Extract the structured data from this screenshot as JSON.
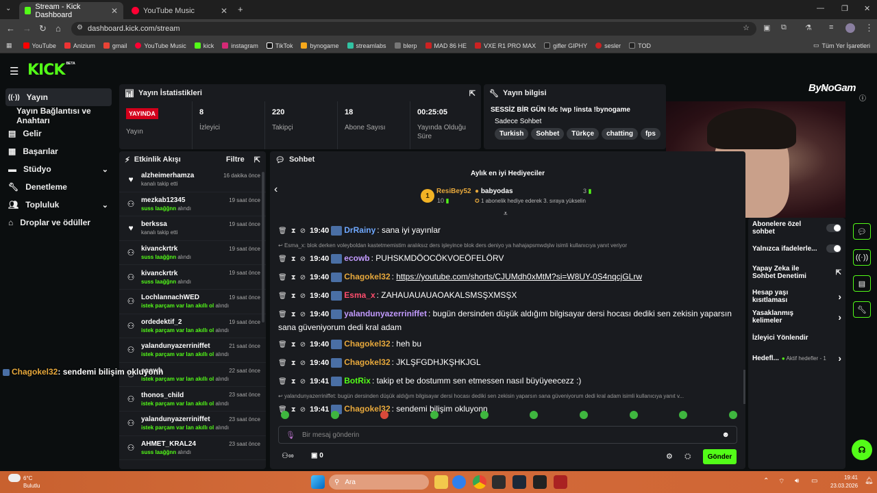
{
  "browser": {
    "tabs": [
      {
        "title": "Stream - Kick Dashboard",
        "active": true
      },
      {
        "title": "YouTube Music",
        "active": false
      }
    ],
    "url": "dashboard.kick.com/stream",
    "bookmarks": [
      "YouTube",
      "Anizium",
      "gmail",
      "YouTube Music",
      "kick",
      "instagram",
      "TikTok",
      "bynogame",
      "streamlabs",
      "blerp",
      "MAD 86 HE",
      "VXE R1 PRO MAX",
      "gifler GIPHY",
      "sesler",
      "TOD"
    ],
    "bookmarks_all": "Tüm Yer İşaretleri"
  },
  "kick": {
    "logo": "KICK",
    "beta": "BETA"
  },
  "sidebar": {
    "items": [
      {
        "label": "Yayın"
      },
      {
        "label": "Yayın Bağlantısı ve Anahtarı"
      },
      {
        "label": "Gelir"
      },
      {
        "label": "Başarılar"
      },
      {
        "label": "Stüdyo"
      },
      {
        "label": "Denetleme"
      },
      {
        "label": "Topluluk"
      },
      {
        "label": "Droplar ve ödüller"
      }
    ]
  },
  "stats": {
    "title": "Yayın İstatistikleri",
    "live_badge": "YAYINDA",
    "live_label": "Yayın",
    "cells": [
      {
        "value": "8",
        "label": "İzleyici"
      },
      {
        "value": "220",
        "label": "Takipçi"
      },
      {
        "value": "18",
        "label": "Abone Sayısı"
      },
      {
        "value": "00:25:05",
        "label": "Yayında Olduğu Süre"
      }
    ]
  },
  "info": {
    "title": "Yayın bilgisi",
    "stream_title": "SESSİZ BİR GÜN !dc !wp !insta !bynogame",
    "category": "Sadece Sohbet",
    "tags": [
      "Turkish",
      "Sohbet",
      "Türkçe",
      "chatting",
      "fps"
    ]
  },
  "overlay": {
    "brand": "ByNoGam"
  },
  "activity": {
    "title": "Etkinlik Akışı",
    "filter": "Filtre",
    "items": [
      {
        "name": "alzheimerhamza",
        "sub": "kanalı takip etti",
        "reward": "",
        "time": "16 dakika önce",
        "type": "follow"
      },
      {
        "name": "mezkab12345",
        "sub": "alındı",
        "reward": "suss laağğnn",
        "time": "19 saat önce",
        "type": "reward"
      },
      {
        "name": "berkssa",
        "sub": "kanalı takip etti",
        "reward": "",
        "time": "19 saat önce",
        "type": "follow"
      },
      {
        "name": "kivanckrtrk",
        "sub": "alındı",
        "reward": "suss laağğnn",
        "time": "19 saat önce",
        "type": "reward"
      },
      {
        "name": "kivanckrtrk",
        "sub": "alındı",
        "reward": "suss laağğnn",
        "time": "19 saat önce",
        "type": "reward"
      },
      {
        "name": "LochlannachWED",
        "sub": "alındı",
        "reward": "istek parçam var lan akıllı ol",
        "time": "19 saat önce",
        "type": "reward"
      },
      {
        "name": "ordedektif_2",
        "sub": "alındı",
        "reward": "istek parçam var lan akıllı ol",
        "time": "19 saat önce",
        "type": "reward"
      },
      {
        "name": "yalandunyazerriniffet",
        "sub": "alındı",
        "reward": "istek parçam var lan akıllı ol",
        "time": "21 saat önce",
        "type": "reward"
      },
      {
        "name": "ecowb",
        "sub": "alındı",
        "reward": "istek parçam var lan akıllı ol",
        "time": "22 saat önce",
        "type": "reward"
      },
      {
        "name": "thonos_child",
        "sub": "alındı",
        "reward": "istek parçam var lan akıllı ol",
        "time": "23 saat önce",
        "type": "reward"
      },
      {
        "name": "yalandunyazerriniffet",
        "sub": "alındı",
        "reward": "istek parçam var lan akıllı ol",
        "time": "23 saat önce",
        "type": "reward"
      },
      {
        "name": "AHMET_KRAL24",
        "sub": "alındı",
        "reward": "suss laağğnn",
        "time": "23 saat önce",
        "type": "reward"
      }
    ]
  },
  "floating_chat": {
    "user": "Chagokel32",
    "text": ": sendemi bilişim okluyonn"
  },
  "chat": {
    "title": "Sohbet",
    "gifters_title": "Aylık en iyi Hediyeciler",
    "top_gifter": {
      "rank": "1",
      "name": "ResiBey52",
      "count": "10"
    },
    "second": {
      "name": "babyodas",
      "count": "3",
      "note": "1 abonelik hediye ederek 3. sıraya yükselin"
    },
    "messages": [
      {
        "time": "19:40",
        "user": "DrRainy",
        "color": "#6fa8ff",
        "text": ": sana iyi yayınlar"
      },
      {
        "reply": "Esma_x: blok derken voleyboldan kastetmemistim aralıksız ders işleyince blok ders deniyo ya hahajapsmwdşlw isimli kullanıcıya yanıt veriyor"
      },
      {
        "time": "19:40",
        "user": "ecowb",
        "color": "#c39bff",
        "text": ": PUHSKMDÖOCÖKVOEÖFELÖRV"
      },
      {
        "time": "19:40",
        "user": "Chagokel32",
        "color": "#e8a93c",
        "text": ": ",
        "link": "https://youtube.com/shorts/CJUMdh0xMtM?si=W8UY-0S4nqcjGLrw"
      },
      {
        "time": "19:40",
        "user": "Esma_x",
        "color": "#ff4d6d",
        "text": ": ZAHAUAUAUAOAKALSMSŞXMSŞX"
      },
      {
        "time": "19:40",
        "user": "yalandunyazerriniffet",
        "color": "#c39bff",
        "text": ": bugün dersinden düşük aldığım bilgisayar dersi hocası dediki sen zekisin yaparsın sana güveniyorum dedi kral adam"
      },
      {
        "time": "19:40",
        "user": "Chagokel32",
        "color": "#e8a93c",
        "text": ": heh bu"
      },
      {
        "time": "19:40",
        "user": "Chagokel32",
        "color": "#e8a93c",
        "text": ": JKLŞFGDHJKŞHKJGL"
      },
      {
        "time": "19:41",
        "user": "BotRix",
        "color": "#53fc18",
        "text": ": takip et be dostumm sen etmessen nasıl büyüyeecezz :)"
      },
      {
        "reply": "yalandunyazerriniffet: bugün dersinden düşük aldığım bilgisayar dersi hocası dediki sen zekisin yaparsın sana güveniyorum dedi kral adam isimli kullanıcıya yanıt v..."
      },
      {
        "time": "19:41",
        "user": "Chagokel32",
        "color": "#e8a93c",
        "text": ": sendemi bilişim okluyonn"
      }
    ],
    "input_placeholder": "Bir mesaj gönderin",
    "points": "0",
    "send": "Gönder"
  },
  "settings": {
    "items": [
      {
        "label": "Abonelere özel sohbet",
        "control": "toggle"
      },
      {
        "label": "Yalnızca ifadelerle...",
        "control": "toggle"
      },
      {
        "label": "Yapay Zeka ile Sohbet Denetimi",
        "control": "external"
      },
      {
        "label": "Hesap yaşı kısıtlaması",
        "control": "chevron"
      },
      {
        "label": "Yasaklanmış kelimeler",
        "control": "chevron"
      },
      {
        "label": "İzleyici Yönlendir",
        "control": "none"
      },
      {
        "label": "Hedefl...",
        "control": "chevron",
        "extra": "Aktif hedefler - 1"
      }
    ]
  },
  "taskbar": {
    "weather_temp": "6°C",
    "weather_desc": "Bulutlu",
    "search": "Ara",
    "time": "19:41",
    "date": "23.03.2026"
  }
}
